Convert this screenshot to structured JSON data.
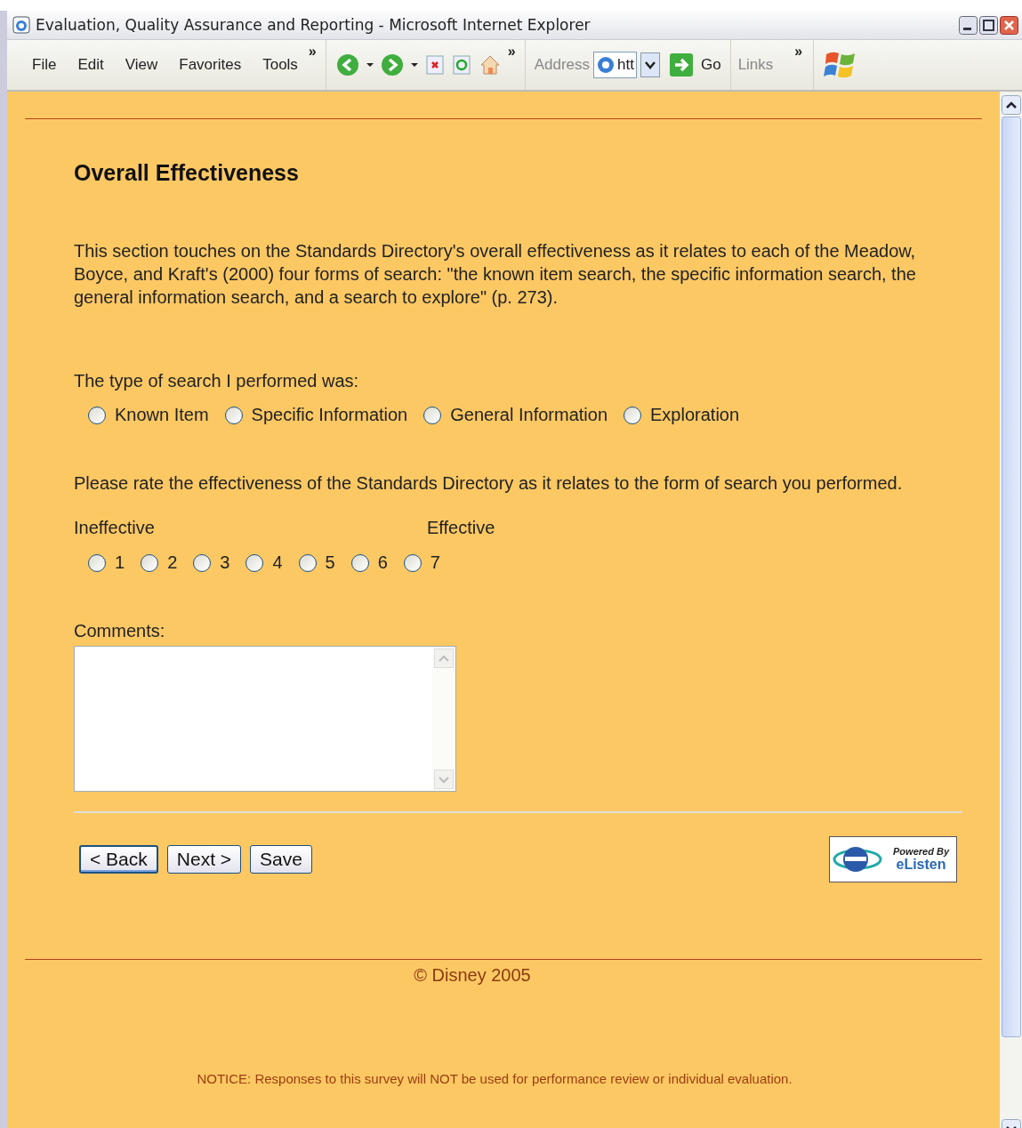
{
  "window": {
    "title": "Evaluation, Quality Assurance and Reporting - Microsoft Internet Explorer"
  },
  "menu": [
    "File",
    "Edit",
    "View",
    "Favorites",
    "Tools"
  ],
  "toolbar": {
    "chevrons": [
      "»",
      "»",
      "»"
    ],
    "address_label": "Address",
    "address_value": "htt",
    "go": "Go",
    "links": "Links"
  },
  "page": {
    "heading": "Overall Effectiveness",
    "intro": "This section touches on the Standards Directory's overall effectiveness as it relates to each of the Meadow, Boyce, and Kraft's (2000) four forms of search: \"the known item search, the specific information search, the general information search, and a search to explore\" (p. 273).",
    "search_question": "The type of search I performed was:",
    "search_options": [
      {
        "label": "Known Item",
        "selected": false
      },
      {
        "label": "Specific Information",
        "selected": false
      },
      {
        "label": "General Information",
        "selected": false
      },
      {
        "label": "Exploration",
        "selected": false
      }
    ],
    "rating_question": "Please rate the effectiveness of the Standards Directory as it relates to the form of search you performed.",
    "scale_low": "Ineffective",
    "scale_high": "Effective",
    "ratings": [
      {
        "label": "1",
        "selected": false
      },
      {
        "label": "2",
        "selected": false
      },
      {
        "label": "3",
        "selected": false
      },
      {
        "label": "4",
        "selected": false
      },
      {
        "label": "5",
        "selected": false
      },
      {
        "label": "6",
        "selected": false
      },
      {
        "label": "7",
        "selected": false
      }
    ],
    "comments_label": "Comments:",
    "buttons": [
      "< Back",
      "Next >",
      "Save"
    ],
    "badge": {
      "line1": "Powered By",
      "line2": "eListen"
    },
    "footer": "© Disney 2005",
    "notice": "NOTICE: Responses to this survey will NOT be used for performance review or individual evaluation."
  }
}
